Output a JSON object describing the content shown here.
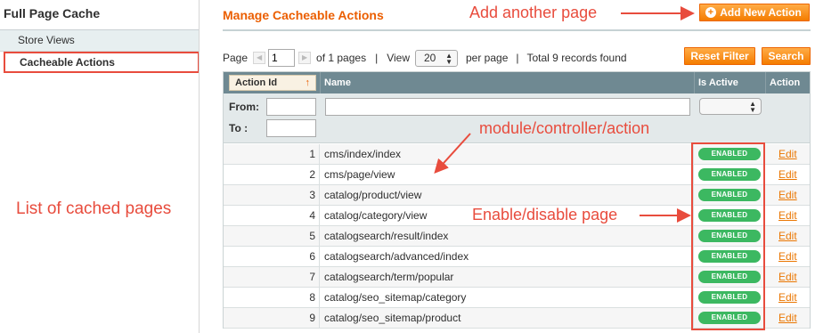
{
  "sidebar": {
    "title": "Full Page Cache",
    "items": [
      {
        "label": "Store Views"
      },
      {
        "label": "Cacheable Actions"
      }
    ]
  },
  "main": {
    "title": "Manage Cacheable Actions",
    "add_button": "Add New Action",
    "reset_button": "Reset Filter",
    "search_button": "Search"
  },
  "pager": {
    "page_label": "Page",
    "page_value": "1",
    "of_pages": "of 1 pages",
    "sep1": "|",
    "view_label": "View",
    "view_value": "20",
    "per_page": "per page",
    "sep2": "|",
    "total": "Total 9 records found"
  },
  "grid": {
    "columns": {
      "id": "Action Id",
      "name": "Name",
      "active": "Is Active",
      "action": "Action"
    },
    "sort_indicator": "↑",
    "filter": {
      "from": "From:",
      "to": "To :"
    },
    "rows": [
      {
        "id": "1",
        "name": "cms/index/index",
        "status": "ENABLED",
        "action": "Edit"
      },
      {
        "id": "2",
        "name": "cms/page/view",
        "status": "ENABLED",
        "action": "Edit"
      },
      {
        "id": "3",
        "name": "catalog/product/view",
        "status": "ENABLED",
        "action": "Edit"
      },
      {
        "id": "4",
        "name": "catalog/category/view",
        "status": "ENABLED",
        "action": "Edit"
      },
      {
        "id": "5",
        "name": "catalogsearch/result/index",
        "status": "ENABLED",
        "action": "Edit"
      },
      {
        "id": "6",
        "name": "catalogsearch/advanced/index",
        "status": "ENABLED",
        "action": "Edit"
      },
      {
        "id": "7",
        "name": "catalogsearch/term/popular",
        "status": "ENABLED",
        "action": "Edit"
      },
      {
        "id": "8",
        "name": "catalog/seo_sitemap/category",
        "status": "ENABLED",
        "action": "Edit"
      },
      {
        "id": "9",
        "name": "catalog/seo_sitemap/product",
        "status": "ENABLED",
        "action": "Edit"
      }
    ]
  },
  "annotations": {
    "add": "Add another page",
    "module": "module/controller/action",
    "enable": "Enable/disable page",
    "list": "List of cached pages"
  },
  "colors": {
    "accent": "#eb5e00",
    "annotation": "#e84c3d",
    "enabled": "#3cb861",
    "header": "#6f8992"
  }
}
